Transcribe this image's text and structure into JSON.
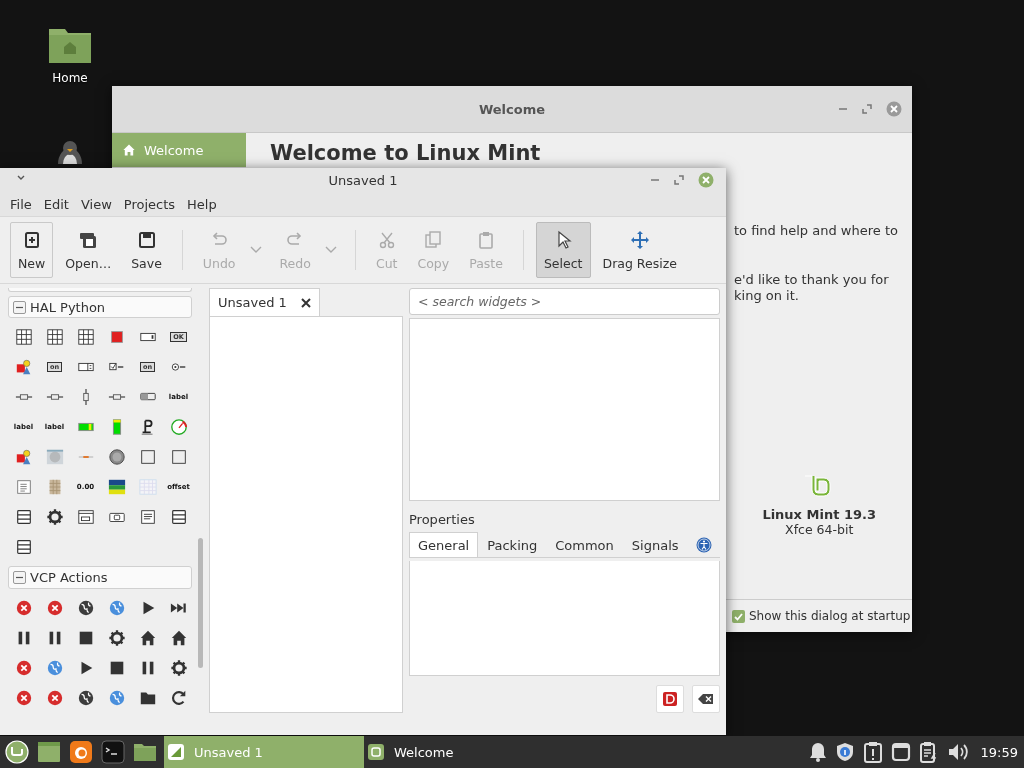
{
  "desktop_icons": [
    {
      "kind": "folder",
      "label": "Home"
    },
    {
      "kind": "penguin"
    }
  ],
  "welcome_window": {
    "title": "Welcome",
    "sidebar": [
      {
        "label": "Welcome",
        "selected": true
      }
    ],
    "heading": "Welcome to Linux Mint",
    "paragraphs": [
      [
        "to find help and where to"
      ],
      [
        "e'd like to thank you for",
        "king on it."
      ]
    ],
    "product": "Linux Mint 19.3",
    "edition": "Xfce 64-bit",
    "startup_checkbox": {
      "label": "Show this dialog at startup",
      "checked": true
    }
  },
  "glade_window": {
    "title": "Unsaved 1",
    "menu": [
      "File",
      "Edit",
      "View",
      "Projects",
      "Help"
    ],
    "toolbar": [
      {
        "kind": "button",
        "label": "New",
        "disabled": false,
        "selected": false,
        "focused": true
      },
      {
        "kind": "button",
        "label": "Open…",
        "disabled": false,
        "selected": false,
        "focused": false
      },
      {
        "kind": "button",
        "label": "Save",
        "disabled": false,
        "selected": false,
        "focused": false
      },
      {
        "kind": "separator"
      },
      {
        "kind": "split",
        "label": "Undo",
        "disabled": true,
        "selected": false,
        "focused": false
      },
      {
        "kind": "split",
        "label": "Redo",
        "disabled": true,
        "selected": false,
        "focused": false
      },
      {
        "kind": "separator"
      },
      {
        "kind": "button",
        "label": "Cut",
        "disabled": true,
        "selected": false,
        "focused": false
      },
      {
        "kind": "button",
        "label": "Copy",
        "disabled": true,
        "selected": false,
        "focused": false
      },
      {
        "kind": "button",
        "label": "Paste",
        "disabled": true,
        "selected": false,
        "focused": false
      },
      {
        "kind": "separator"
      },
      {
        "kind": "button",
        "label": "Select",
        "disabled": false,
        "selected": true,
        "focused": false
      },
      {
        "kind": "button",
        "label": "Drag Resize",
        "disabled": false,
        "selected": false,
        "focused": false
      }
    ],
    "palette": [
      {
        "title": "HAL Python",
        "expanded": true,
        "items": [
          {
            "kind": "grid"
          },
          {
            "kind": "grid"
          },
          {
            "kind": "grid"
          },
          {
            "kind": "filled-square"
          },
          {
            "kind": "combo-box"
          },
          {
            "kind": "button-text",
            "text": "OK"
          },
          {
            "kind": "person"
          },
          {
            "kind": "button-text",
            "text": "on"
          },
          {
            "kind": "spin"
          },
          {
            "kind": "checkbox"
          },
          {
            "kind": "button-text",
            "text": "on"
          },
          {
            "kind": "radio"
          },
          {
            "kind": "slider"
          },
          {
            "kind": "slider"
          },
          {
            "kind": "vertical-slider"
          },
          {
            "kind": "slider"
          },
          {
            "kind": "switch"
          },
          {
            "kind": "label-text",
            "text": "label"
          },
          {
            "kind": "label-text",
            "text": "label"
          },
          {
            "kind": "label-text",
            "text": "label"
          },
          {
            "kind": "progress-bar"
          },
          {
            "kind": "vertical-bar"
          },
          {
            "kind": "p-symbol"
          },
          {
            "kind": "gauge"
          },
          {
            "kind": "person"
          },
          {
            "kind": "disc-image"
          },
          {
            "kind": "led-line"
          },
          {
            "kind": "knob"
          },
          {
            "kind": "square"
          },
          {
            "kind": "square"
          },
          {
            "kind": "document"
          },
          {
            "kind": "texture"
          },
          {
            "kind": "label-text",
            "text": "0.00"
          },
          {
            "kind": "chart-image"
          },
          {
            "kind": "table-image"
          },
          {
            "kind": "label-text",
            "text": "offset"
          },
          {
            "kind": "rows"
          },
          {
            "kind": "gear"
          },
          {
            "kind": "window"
          },
          {
            "kind": "small-folder"
          },
          {
            "kind": "lines"
          },
          {
            "kind": "rows"
          },
          {
            "kind": "rows"
          }
        ]
      },
      {
        "title": "VCP Actions",
        "expanded": true,
        "items": [
          {
            "kind": "error-circle"
          },
          {
            "kind": "error-circle"
          },
          {
            "kind": "globe",
            "color": "#3d3d3d"
          },
          {
            "kind": "globe",
            "color": "#4a8fdc"
          },
          {
            "kind": "play"
          },
          {
            "kind": "skip-forward"
          },
          {
            "kind": "pause"
          },
          {
            "kind": "pause"
          },
          {
            "kind": "stop"
          },
          {
            "kind": "gear"
          },
          {
            "kind": "home"
          },
          {
            "kind": "home"
          },
          {
            "kind": "error-circle"
          },
          {
            "kind": "globe",
            "color": "#4a8fdc"
          },
          {
            "kind": "play"
          },
          {
            "kind": "stop"
          },
          {
            "kind": "pause"
          },
          {
            "kind": "gear"
          },
          {
            "kind": "error-circle"
          },
          {
            "kind": "error-circle"
          },
          {
            "kind": "globe",
            "color": "#3d3d3d"
          },
          {
            "kind": "globe",
            "color": "#4a8fdc"
          },
          {
            "kind": "folder"
          },
          {
            "kind": "refresh"
          }
        ]
      }
    ],
    "document_tabs": [
      {
        "label": "Unsaved 1",
        "selected": true
      }
    ],
    "search": {
      "placeholder": "< search widgets >"
    },
    "properties": {
      "title": "Properties",
      "tabs": [
        {
          "label": "General",
          "selected": true
        },
        {
          "label": "Packing",
          "selected": false
        },
        {
          "label": "Common",
          "selected": false
        },
        {
          "label": "Signals",
          "selected": false
        }
      ]
    }
  },
  "taskbar": {
    "tasks": [
      {
        "label": "Unsaved 1",
        "selected": true
      },
      {
        "label": "Welcome",
        "selected": false
      }
    ],
    "clock": "19:59"
  }
}
